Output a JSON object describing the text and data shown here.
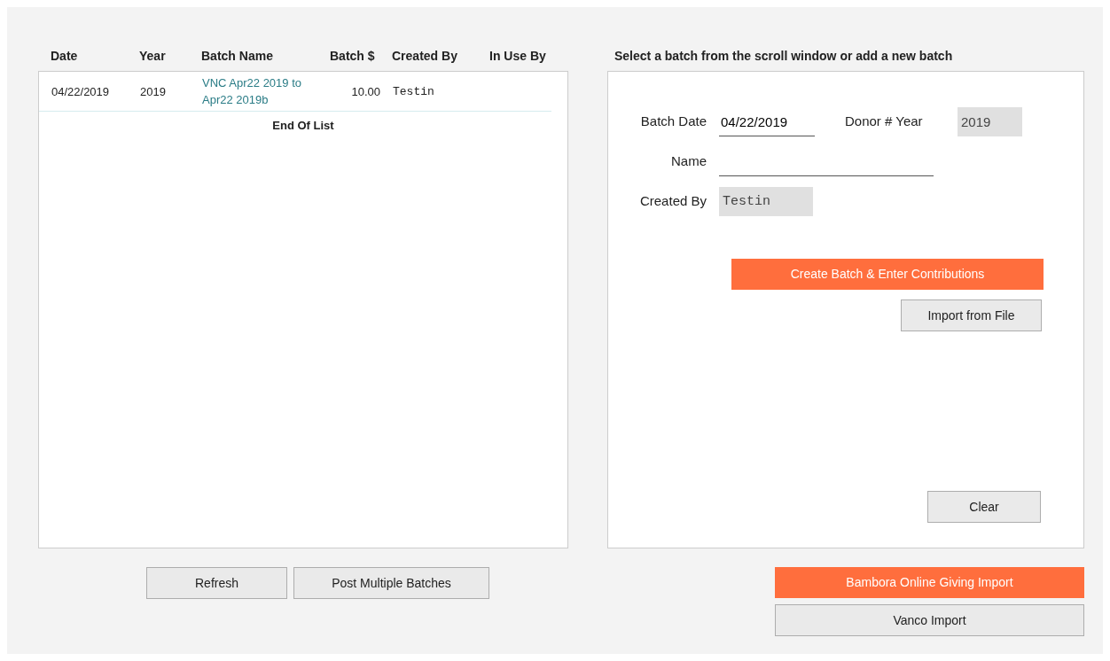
{
  "batch_list": {
    "columns": [
      "Date",
      "Year",
      "Batch Name",
      "Batch $",
      "Created By",
      "In Use By"
    ],
    "rows": [
      {
        "date": "04/22/2019",
        "year": "2019",
        "batch_name": "VNC Apr22 2019 to Apr22 2019b",
        "amount": "10.00",
        "created_by": "Testin"
      }
    ],
    "end_text": "End Of List"
  },
  "list_buttons": [
    {
      "label": "Refresh"
    },
    {
      "label": "Post Multiple Batches"
    }
  ],
  "form": {
    "title": "Select a batch from the scroll window or add a new batch",
    "batch_date": {
      "label": "Batch Date",
      "value": "04/22/2019"
    },
    "donor_year": {
      "label": "Donor # Year",
      "value": "2019",
      "disabled": true
    },
    "name": {
      "label": "Name"
    },
    "created_by": {
      "label": "Created By",
      "value": "Testin",
      "disabled": true
    },
    "create_button": {
      "label": "Create Batch & Enter Contributions",
      "kind": "primary"
    },
    "import_button": {
      "label": "Import from File"
    },
    "clear_button": {
      "label": "Clear"
    }
  },
  "import_buttons": [
    {
      "label": "Bambora Online Giving Import",
      "kind": "primary"
    },
    {
      "label": "Vanco Import"
    }
  ]
}
